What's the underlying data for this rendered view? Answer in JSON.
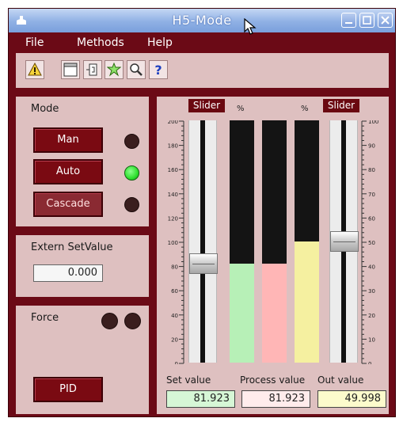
{
  "window": {
    "title": "H5-Mode"
  },
  "menu": {
    "file": "File",
    "methods": "Methods",
    "help": "Help"
  },
  "toolbar": {
    "buttons": [
      "warning-icon",
      "graph-icon",
      "object-icon",
      "trend-icon",
      "zoom-icon",
      "help-icon"
    ],
    "help_glyph": "?"
  },
  "mode_panel": {
    "title": "Mode",
    "buttons": [
      {
        "label": "Man",
        "led_on": false
      },
      {
        "label": "Auto",
        "led_on": true
      },
      {
        "label": "Cascade",
        "led_on": false
      }
    ]
  },
  "extern_panel": {
    "title": "Extern SetValue",
    "value": "0.000"
  },
  "force_panel": {
    "title": "Force",
    "leds_on": [
      false,
      false
    ],
    "button_label": "PID"
  },
  "trend": {
    "left_slider_label": "Slider",
    "right_slider_label": "Slider",
    "pct_label_1": "%",
    "pct_label_2": "%",
    "left_scale": {
      "min": 0,
      "max": 200,
      "ticks": [
        "200",
        "180",
        "160",
        "140",
        "120",
        "100",
        "80",
        "60",
        "40",
        "20",
        "0"
      ]
    },
    "right_scale": {
      "min": 0,
      "max": 100,
      "ticks": [
        "100",
        "90",
        "80",
        "70",
        "60",
        "50",
        "40",
        "30",
        "20",
        "10",
        "0"
      ]
    },
    "setpoint_slider_value": 81.923,
    "out_slider_value": 49.998,
    "bars": [
      {
        "name": "set-value",
        "value": 81.923,
        "max": 200,
        "color": "#b7f0b7"
      },
      {
        "name": "process-value",
        "value": 81.923,
        "max": 200,
        "color": "#ffb6b6"
      },
      {
        "name": "out-value",
        "value": 49.998,
        "max": 100,
        "color": "#f5f0a0"
      }
    ],
    "labels": {
      "set": "Set value",
      "process": "Process value",
      "out": "Out value"
    },
    "values": {
      "set": "81.923",
      "process": "81.923",
      "out": "49.998"
    },
    "value_colors": {
      "set": "#d6f7d6",
      "process": "#ffecec",
      "out": "#fcfbcc"
    }
  }
}
